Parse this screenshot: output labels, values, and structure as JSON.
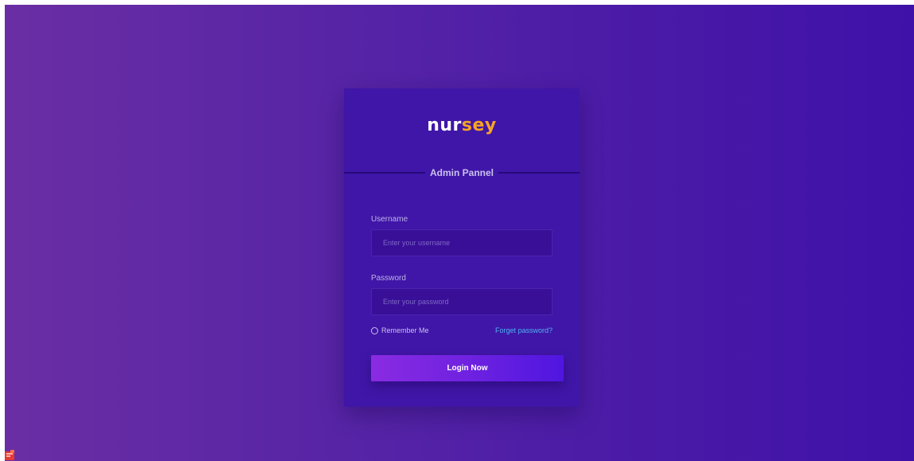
{
  "brand": {
    "logo_part1": "nur",
    "logo_part2": "sey"
  },
  "panel": {
    "title": "Admin Pannel"
  },
  "form": {
    "username_label": "Username",
    "username_placeholder": "Enter your username",
    "username_value": "",
    "password_label": "Password",
    "password_placeholder": "Enter your password",
    "password_value": "",
    "remember_label": "Remember Me",
    "forgot_link": "Forget password?",
    "submit_label": "Login Now"
  },
  "colors": {
    "background_start": "#6a2ea4",
    "background_end": "#3f11a8",
    "card": "#4016a8",
    "logo_accent": "#f7a524",
    "link": "#4fb1f2",
    "button_start": "#8a2be2",
    "button_end": "#4f16e0"
  },
  "icons": {
    "corner": "app-badge-icon"
  }
}
